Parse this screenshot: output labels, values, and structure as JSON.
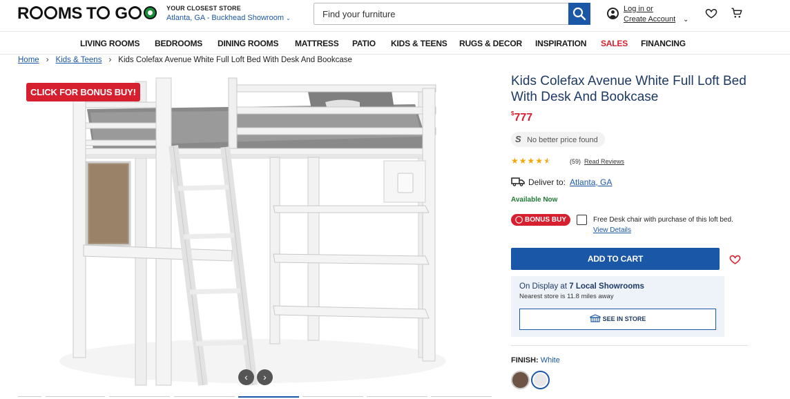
{
  "header": {
    "logo_text": "ROOMS TO GO",
    "store_label": "YOUR CLOSEST STORE",
    "store_name": "Atlanta, GA - Buckhead Showroom",
    "search_placeholder": "Find your furniture",
    "login_label": "Log in or",
    "create_account_label": "Create Account"
  },
  "nav": {
    "items": [
      "LIVING ROOMS",
      "BEDROOMS",
      "DINING ROOMS",
      "MATTRESS",
      "PATIO",
      "KIDS & TEENS",
      "RUGS & DECOR",
      "INSPIRATION",
      "SALES",
      "FINANCING"
    ]
  },
  "breadcrumb": {
    "home": "Home",
    "category": "Kids & Teens",
    "current": "Kids Colefax Avenue White Full Loft Bed With Desk And Bookcase"
  },
  "gallery": {
    "bonus_flag": "CLICK FOR BONUS BUY!",
    "active_thumb": 4
  },
  "product": {
    "title": "Kids Colefax Avenue White Full Loft Bed With Desk And Bookcase",
    "price_symbol": "$",
    "price": "777",
    "price_match": "No better price found",
    "rating": 4.5,
    "review_count": "(59)",
    "read_reviews": "Read Reviews",
    "deliver_label": "Deliver to:",
    "deliver_location": "Atlanta, GA",
    "availability": "Available Now",
    "bonus_badge": "BONUS BUY",
    "bonus_text": "Free Desk chair with purchase of this loft bed.",
    "view_details": "View Details",
    "add_to_cart": "ADD TO CART",
    "display_prefix": "On Display at",
    "display_showrooms": "7 Local Showrooms",
    "nearest_store": "Nearest store is 11.8 miles away",
    "see_in_store": "SEE IN STORE",
    "finish_label": "FINISH:",
    "finish_value": "White"
  },
  "colors": {
    "brand_blue": "#1a57a6",
    "sale_red": "#d6202f",
    "available_green": "#1f7a35",
    "star_gold": "#f3a800"
  }
}
